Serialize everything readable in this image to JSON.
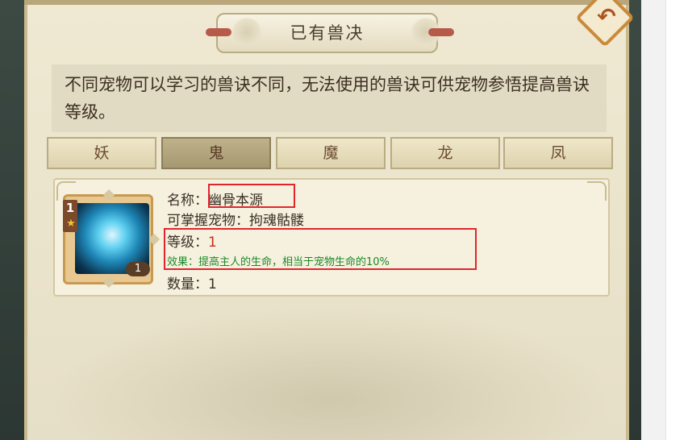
{
  "title": "已有兽决",
  "description": "不同宠物可以学习的兽诀不同，无法使用的兽诀可供宠物参悟提高兽诀等级。",
  "tabs": [
    {
      "label": "妖",
      "active": false
    },
    {
      "label": "鬼",
      "active": true
    },
    {
      "label": "魔",
      "active": false
    },
    {
      "label": "龙",
      "active": false
    },
    {
      "label": "凤",
      "active": false
    }
  ],
  "item": {
    "icon": "ghost-skill-icon",
    "star_level": "1",
    "count_badge": "1",
    "name_label": "名称：",
    "name_value": "幽骨本源",
    "pet_label": "可掌握宠物：",
    "pet_value": "拘魂骷髅",
    "level_label": "等级：",
    "level_value": "1",
    "effect_label": "效果：",
    "effect_value": "提高主人的生命，相当于宠物生命的10%",
    "quantity_label": "数量：",
    "quantity_value": "1"
  },
  "colors": {
    "highlight": "#e0262c",
    "level_value": "#c8281e",
    "effect_text": "#1a8a2a"
  }
}
